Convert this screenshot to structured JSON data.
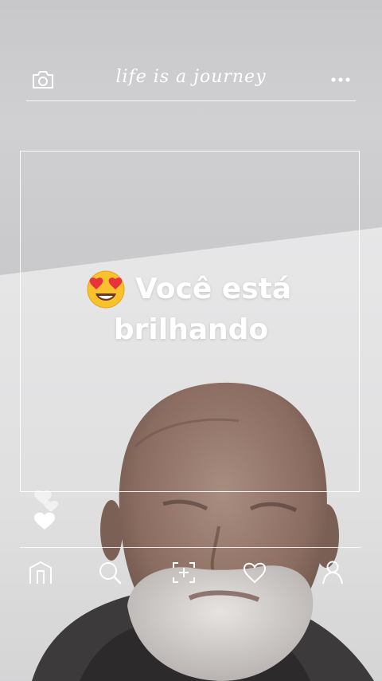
{
  "header": {
    "title": "life is a journey",
    "camera_icon": "camera-icon",
    "more_icon": "more-dots-icon"
  },
  "caption": {
    "emoji_icon": "heart-eyes-emoji-icon",
    "line1": "Você está",
    "line2": "brilhando"
  },
  "reactions": {
    "icon": "floating-hearts-icon"
  },
  "bottom_nav": {
    "items": [
      {
        "icon": "home-icon"
      },
      {
        "icon": "search-icon"
      },
      {
        "icon": "add-post-icon"
      },
      {
        "icon": "heart-icon"
      },
      {
        "icon": "profile-icon"
      }
    ]
  },
  "colors": {
    "overlay_line": "#ffffff",
    "caption_text": "#ffffff"
  }
}
